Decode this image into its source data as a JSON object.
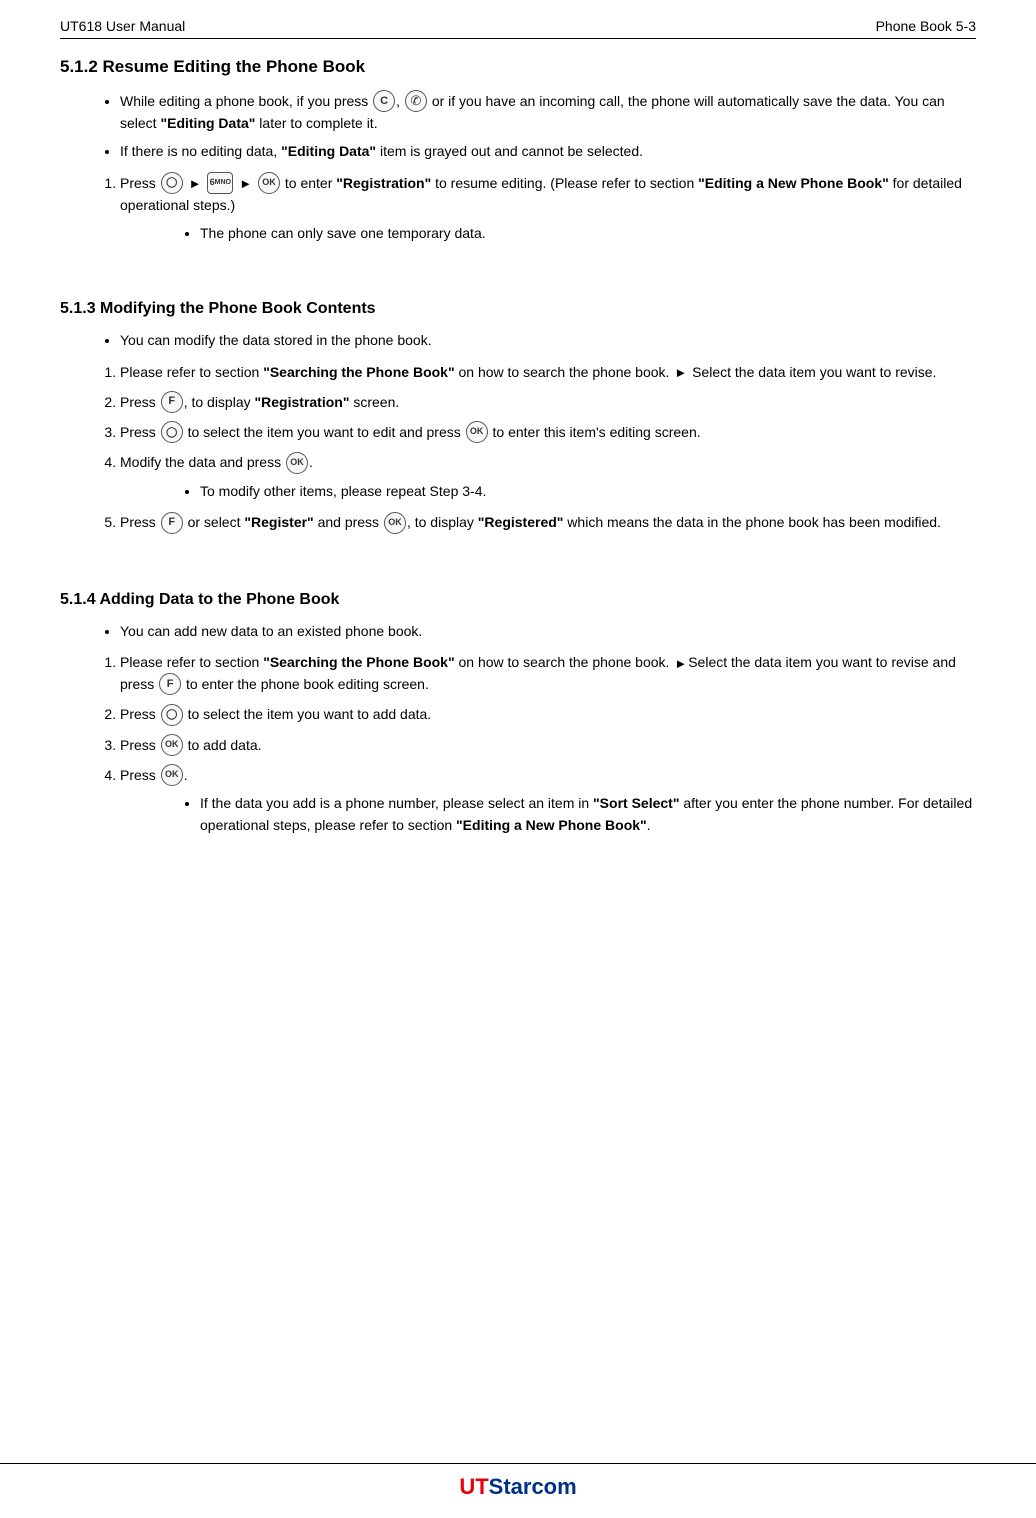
{
  "header": {
    "left": "UT618 User Manual",
    "right": "Phone Book   5-3"
  },
  "sections": [
    {
      "id": "5.1.2",
      "title": "5.1.2 Resume Editing the Phone Book",
      "bullets": [
        {
          "type": "bullet",
          "text": "While editing a phone book, if you press [C], [phone] or if you have an incoming call, the phone will automatically save the data. You can select \"Editing Data\" later to complete it."
        },
        {
          "type": "bullet",
          "text": "If there is no editing data, \"Editing Data\" item is grayed out and cannot be selected."
        }
      ],
      "steps": [
        {
          "num": "1",
          "text": "Press [menu] ▶ [6MNO] ▶ [OK] to enter \"Registration\" to resume editing. (Please refer to section \"Editing a New Phone Book\" for detailed operational steps.)",
          "sub_bullets": [
            "The phone can only save one temporary data."
          ]
        }
      ]
    },
    {
      "id": "5.1.3",
      "title": "5.1.3 Modifying the Phone Book Contents",
      "bullets": [
        {
          "type": "bullet",
          "text": "You can modify the data stored in the phone book."
        }
      ],
      "steps": [
        {
          "num": "1",
          "text": "Please refer to section \"Searching the Phone Book\" on how to search the phone book. ▶ Select the data item you want to revise."
        },
        {
          "num": "2",
          "text": "Press [F], to display \"Registration\" screen."
        },
        {
          "num": "3",
          "text": "Press [menu] to select the item you want to edit and press [OK] to enter this item's editing screen."
        },
        {
          "num": "4",
          "text": "Modify the data and press [OK].",
          "sub_bullets": [
            "To modify other items, please repeat Step 3-4."
          ]
        },
        {
          "num": "5",
          "text": "Press [F] or select \"Register\" and press [OK], to display \"Registered\" which means the data in the phone book has been modified."
        }
      ]
    },
    {
      "id": "5.1.4",
      "title": "5.1.4 Adding Data to the Phone Book",
      "bullets": [
        {
          "type": "bullet",
          "text": "You can add new data to an existed phone book."
        }
      ],
      "steps": [
        {
          "num": "1",
          "text": "Please refer to section \"Searching the Phone Book\" on how to search the phone book. ▶Select the data item you want to revise and press [F] to enter the phone book editing screen."
        },
        {
          "num": "2",
          "text": "Press [menu] to select the item you want to add data."
        },
        {
          "num": "3",
          "text": "Press [OK] to add data."
        },
        {
          "num": "4",
          "text": "Press [OK].",
          "sub_bullets": [
            "If the data you add is a phone number, please select an item in \"Sort Select\" after you enter the phone number. For detailed operational steps, please refer to section \"Editing a New Phone Book\"."
          ]
        }
      ]
    }
  ],
  "footer": {
    "logo_ut": "UT",
    "logo_star": "Starcom"
  },
  "labels": {
    "editing_data": "\"Editing Data\"",
    "registration": "\"Registration\"",
    "editing_new_phone_book": "\"Editing a New Phone Book\"",
    "searching_phone_book": "\"Searching the Phone Book\"",
    "register": "\"Register\"",
    "registered": "\"Registered\"",
    "sort_select": "\"Sort Select\""
  }
}
